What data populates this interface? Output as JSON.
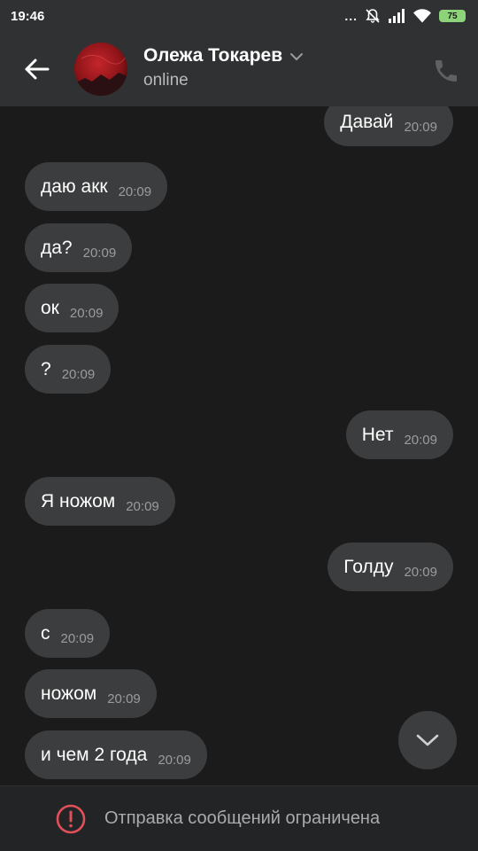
{
  "status_bar": {
    "time": "19:46",
    "dots": "...",
    "battery": "75",
    "icons": [
      "mute-icon",
      "signal-icon",
      "wifi-icon",
      "battery-icon"
    ]
  },
  "header": {
    "contact_name": "Олежа Токарев",
    "contact_status": "online",
    "icons": [
      "back-arrow-icon",
      "chevron-down-icon",
      "phone-icon"
    ]
  },
  "messages": [
    {
      "dir": "out",
      "text": "Давай",
      "time": "20:09"
    },
    {
      "dir": "in",
      "text": "даю акк",
      "time": "20:09"
    },
    {
      "dir": "in",
      "text": "да?",
      "time": "20:09"
    },
    {
      "dir": "in",
      "text": "ок",
      "time": "20:09"
    },
    {
      "dir": "in",
      "text": "?",
      "time": "20:09"
    },
    {
      "dir": "out",
      "text": "Нет",
      "time": "20:09"
    },
    {
      "dir": "in",
      "text": "Я ножом",
      "time": "20:09"
    },
    {
      "dir": "out",
      "text": "Голду",
      "time": "20:09"
    },
    {
      "dir": "in",
      "text": "с",
      "time": "20:09"
    },
    {
      "dir": "in",
      "text": "ножом",
      "time": "20:09"
    },
    {
      "dir": "in",
      "text": "и чем 2 года",
      "time": "20:09"
    }
  ],
  "footer": {
    "restriction_text": "Отправка сообщений ограничена",
    "icon": "alert-circle-icon"
  },
  "colors": {
    "background": "#1b1b1c",
    "header": "#2f3132",
    "bubble": "#3c3d3e",
    "alert": "#e0505a",
    "battery": "#8cd37a"
  }
}
